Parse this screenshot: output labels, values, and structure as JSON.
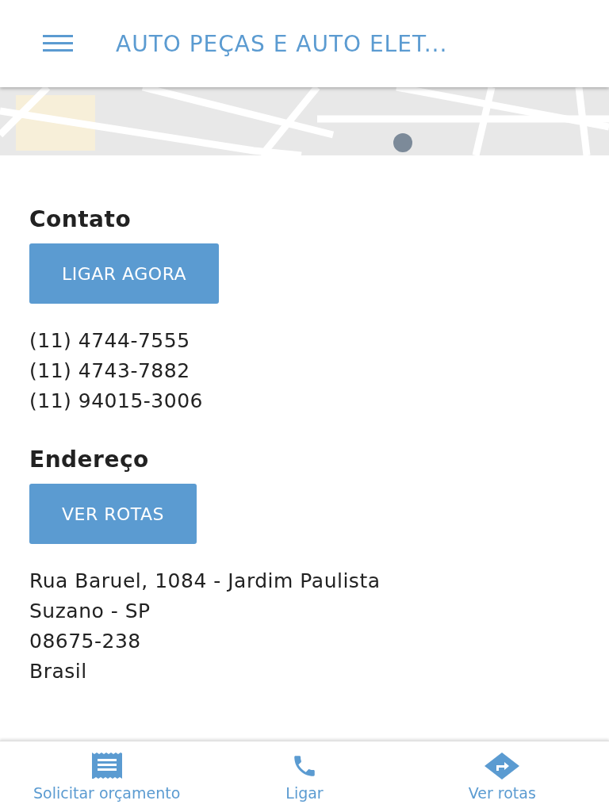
{
  "header": {
    "title": "AUTO PEÇAS E AUTO ELET..."
  },
  "sections": [
    {
      "heading": "Contato",
      "button": "LIGAR AGORA",
      "lines": [
        "(11) 4744-7555",
        "(11) 4743-7882",
        "(11) 94015-3006"
      ]
    },
    {
      "heading": "Endereço",
      "button": "VER ROTAS",
      "lines": [
        "Rua Baruel, 1084 - Jardim Paulista",
        "Suzano - SP",
        "08675-238",
        "Brasil"
      ]
    }
  ],
  "bottom_nav": [
    {
      "kind": "receipt",
      "label": "Solicitar orçamento"
    },
    {
      "kind": "phone",
      "label": "Ligar"
    },
    {
      "kind": "directions",
      "label": "Ver rotas"
    }
  ]
}
